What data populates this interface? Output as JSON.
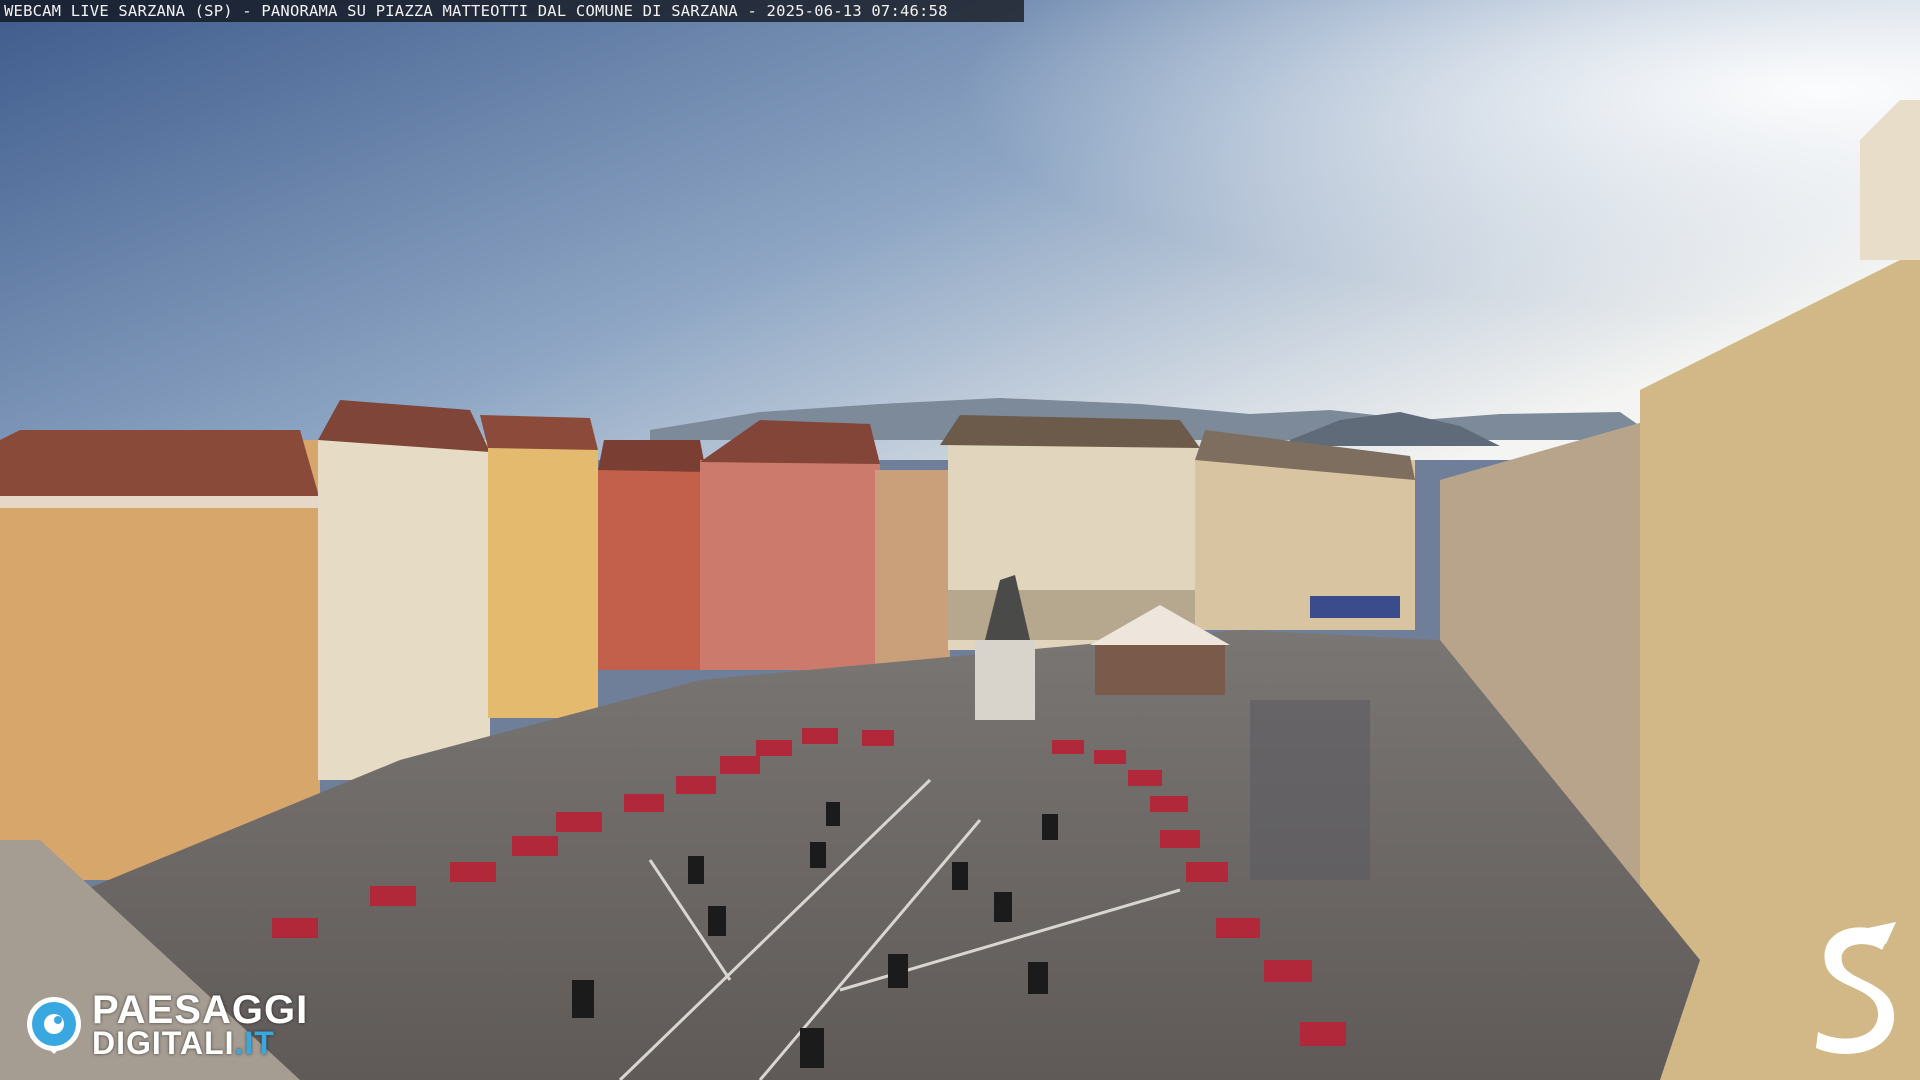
{
  "overlay": {
    "caption": "WEBCAM LIVE SARZANA (SP) - PANORAMA SU PIAZZA MATTEOTTI DAL COMUNE DI SARZANA - 2025-06-13  07:46:58"
  },
  "logo": {
    "line1": "PAESAGGI",
    "line2_main": "DIGITALI",
    "line2_accent": ".IT",
    "icon": "eye-icon"
  },
  "brand_mark": {
    "icon": "s-logo-icon"
  },
  "colors": {
    "sky_top": "#3f5d8f",
    "sky_bottom": "#dfe6ee",
    "logo_accent": "#39a8e0",
    "facade_ochre": "#d7a868",
    "facade_red": "#c0604e",
    "pavement": "#6e6a68"
  }
}
